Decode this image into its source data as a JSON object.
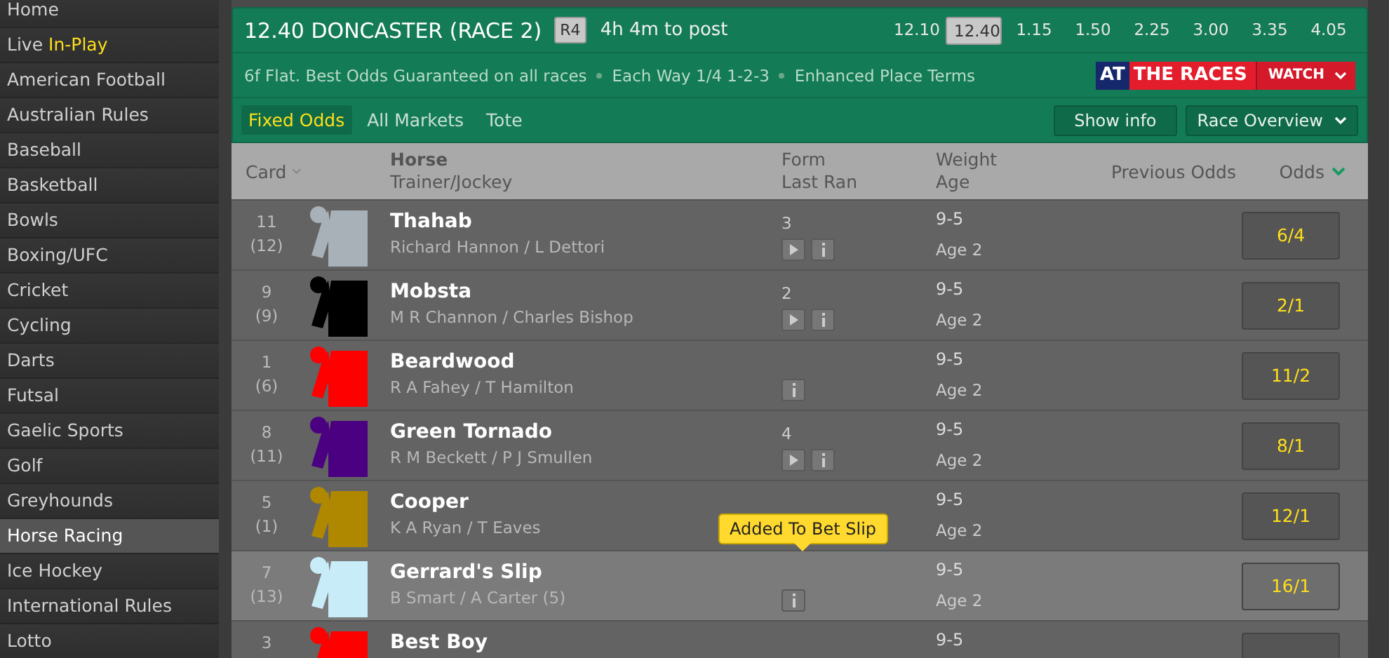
{
  "sidebar": {
    "items": [
      {
        "label": "Home",
        "selected": false
      },
      {
        "label": "Live",
        "highlight": "In-Play",
        "selected": false
      },
      {
        "label": "American Football",
        "selected": false
      },
      {
        "label": "Australian Rules",
        "selected": false
      },
      {
        "label": "Baseball",
        "selected": false
      },
      {
        "label": "Basketball",
        "selected": false
      },
      {
        "label": "Bowls",
        "selected": false
      },
      {
        "label": "Boxing/UFC",
        "selected": false
      },
      {
        "label": "Cricket",
        "selected": false
      },
      {
        "label": "Cycling",
        "selected": false
      },
      {
        "label": "Darts",
        "selected": false
      },
      {
        "label": "Futsal",
        "selected": false
      },
      {
        "label": "Gaelic Sports",
        "selected": false
      },
      {
        "label": "Golf",
        "selected": false
      },
      {
        "label": "Greyhounds",
        "selected": false
      },
      {
        "label": "Horse Racing",
        "selected": true
      },
      {
        "label": "Ice Hockey",
        "selected": false
      },
      {
        "label": "International Rules",
        "selected": false
      },
      {
        "label": "Lotto",
        "selected": false
      }
    ]
  },
  "race": {
    "title": "12.40 DONCASTER (RACE 2)",
    "badge": "R4",
    "countdown": "4h 4m to post",
    "times": [
      {
        "label": "12.10",
        "selected": false
      },
      {
        "label": "12.40",
        "selected": true
      },
      {
        "label": "1.15",
        "selected": false
      },
      {
        "label": "1.50",
        "selected": false
      },
      {
        "label": "2.25",
        "selected": false
      },
      {
        "label": "3.00",
        "selected": false
      },
      {
        "label": "3.35",
        "selected": false
      },
      {
        "label": "4.05",
        "selected": false
      }
    ],
    "terms": [
      "6f Flat. Best Odds Guaranteed on all races",
      "Each Way 1/4 1-2-3",
      "Enhanced Place Terms"
    ],
    "stream": {
      "logo_left": "AT",
      "logo_right": "THE RACES",
      "button": "WATCH"
    },
    "tabs": [
      {
        "label": "Fixed Odds",
        "selected": true
      },
      {
        "label": "All Markets",
        "selected": false
      },
      {
        "label": "Tote",
        "selected": false
      }
    ],
    "buttons": [
      "Show info"
    ],
    "dropdown": "Race Overview"
  },
  "table": {
    "columns": {
      "card": "Card",
      "horse": "Horse",
      "trainer_jockey": "Trainer/Jockey",
      "form": "Form",
      "last_ran": "Last Ran",
      "weight": "Weight",
      "age": "Age",
      "previous_odds": "Previous Odds",
      "odds": "Odds"
    },
    "rows": [
      {
        "card": "11",
        "draw": "(12)",
        "color": "#a8b0b8",
        "name": "Thahab",
        "connections": "Richard Hannon / L Dettori",
        "form": "3",
        "replay": true,
        "info": true,
        "weight": "9-5",
        "age": "Age 2",
        "odds": "6/4",
        "selected": false
      },
      {
        "card": "9",
        "draw": "(9)",
        "color": "#000000",
        "name": "Mobsta",
        "connections": "M R Channon / Charles Bishop",
        "form": "2",
        "replay": true,
        "info": true,
        "weight": "9-5",
        "age": "Age 2",
        "odds": "2/1",
        "selected": false
      },
      {
        "card": "1",
        "draw": "(6)",
        "color": "#ff0000",
        "name": "Beardwood",
        "connections": "R A Fahey / T Hamilton",
        "replay": false,
        "info": true,
        "weight": "9-5",
        "age": "Age 2",
        "odds": "11/2",
        "selected": false
      },
      {
        "card": "8",
        "draw": "(11)",
        "color": "#4b0082",
        "name": "Green Tornado",
        "connections": "R M Beckett / P J Smullen",
        "form": "4",
        "replay": true,
        "info": true,
        "weight": "9-5",
        "age": "Age 2",
        "odds": "8/1",
        "selected": false
      },
      {
        "card": "5",
        "draw": "(1)",
        "color": "#b08800",
        "name": "Cooper",
        "connections": "K A Ryan / T Eaves",
        "replay": false,
        "info": false,
        "weight": "9-5",
        "age": "Age 2",
        "odds": "12/1",
        "selected": false
      },
      {
        "card": "7",
        "draw": "(13)",
        "color": "#c8ecf8",
        "name": "Gerrard's Slip",
        "connections": "B Smart / A Carter (5)",
        "replay": false,
        "info": true,
        "weight": "9-5",
        "age": "Age 2",
        "odds": "16/1",
        "selected": true
      },
      {
        "card": "3",
        "color": "#ff0000",
        "name": "Best Boy",
        "replay": false,
        "info": false,
        "weight": "9-5",
        "selected": false
      }
    ]
  },
  "tooltip": {
    "text": "Added To Bet Slip"
  }
}
